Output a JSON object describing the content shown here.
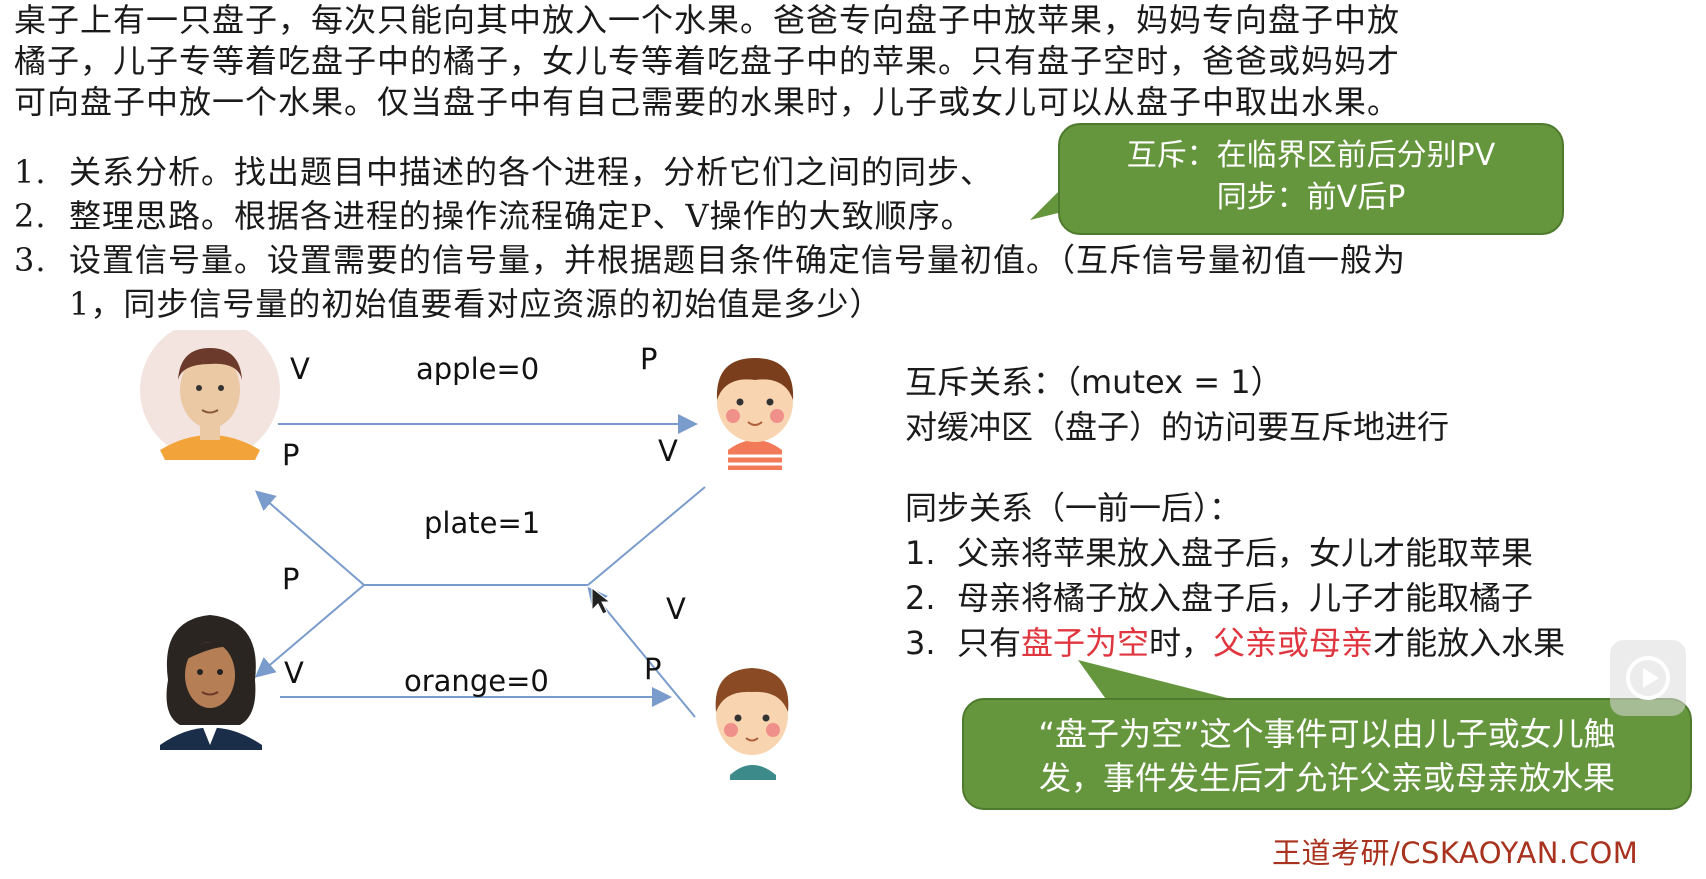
{
  "intro": [
    "桌子上有一只盘子，每次只能向其中放入一个水果。爸爸专向盘子中放苹果，妈妈专向盘子中放",
    "橘子，儿子专等着吃盘子中的橘子，女儿专等着吃盘子中的苹果。只有盘子空时，爸爸或妈妈才",
    "可向盘子中放一个水果。仅当盘子中有自己需要的水果时，儿子或女儿可以从盘子中取出水果。"
  ],
  "steps": [
    {
      "num": "1.",
      "text": "关系分析。找出题目中描述的各个进程，分析它们之间的同步、"
    },
    {
      "num": "2.",
      "text": "整理思路。根据各进程的操作流程确定P、V操作的大致顺序。"
    },
    {
      "num": "3.",
      "text": "设置信号量。设置需要的信号量，并根据题目条件确定信号量初值。（互斥信号量初值一般为"
    }
  ],
  "step3_cont": "1，同步信号量的初始值要看对应资源的初始值是多少）",
  "callout_top": {
    "line1": "互斥：在临界区前后分别PV",
    "line2": "同步：前V后P"
  },
  "diagram": {
    "apple": "apple=0",
    "plate": "plate=1",
    "orange": "orange=0",
    "v_father": "V",
    "p_daughter": "P",
    "p_father": "P",
    "v_daughter": "V",
    "p_mother": "P",
    "v_son": "V",
    "v_mother": "V",
    "p_son": "P"
  },
  "right": {
    "mutex_title": "互斥关系：（mutex = 1）",
    "mutex_desc": "对缓冲区（盘子）的访问要互斥地进行",
    "sync_title": "同步关系（一前一后）：",
    "items": [
      {
        "num": "1.",
        "text": "父亲将苹果放入盘子后，女儿才能取苹果"
      },
      {
        "num": "2.",
        "text": "母亲将橘子放入盘子后，儿子才能取橘子"
      }
    ],
    "item3": {
      "num": "3.",
      "pre": "只有",
      "red1": "盘子为空",
      "mid": "时，",
      "red2": "父亲或母亲",
      "post": "才能放入水果"
    }
  },
  "callout_bottom": {
    "line1": "“盘子为空”这个事件可以由儿子或女儿触",
    "line2": "发，事件发生后才允许父亲或母亲放水果"
  },
  "footer": "王道考研/CSKAOYAN.COM",
  "colors": {
    "accent_green": "#65963d",
    "highlight_red": "#e0363f",
    "arrow_blue": "#7a9ccc",
    "footer": "#a8321e"
  }
}
